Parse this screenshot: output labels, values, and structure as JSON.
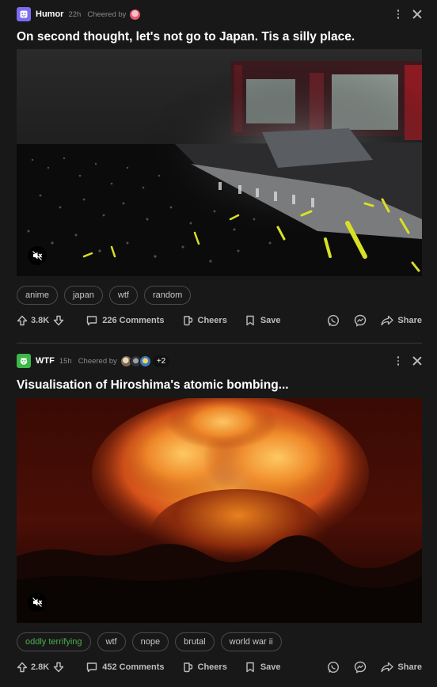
{
  "posts": [
    {
      "category": "Humor",
      "category_color": "#7c6cf0",
      "time": "22h",
      "cheered_by_label": "Cheered by",
      "extra_cheerers": "",
      "title": "On second thought, let's not go to Japan. Tis a silly place.",
      "tags": [
        "anime",
        "japan",
        "wtf",
        "random"
      ],
      "votes": "3.8K",
      "comments": "226 Comments",
      "cheers": "Cheers",
      "save": "Save",
      "share": "Share"
    },
    {
      "category": "WTF",
      "category_color": "#3cb84a",
      "time": "15h",
      "cheered_by_label": "Cheered by",
      "extra_cheerers": "+2",
      "title": "Visualisation of Hiroshima's atomic bombing...",
      "tags": [
        "oddly terrifying",
        "wtf",
        "nope",
        "brutal",
        "world war ii"
      ],
      "votes": "2.8K",
      "comments": "452 Comments",
      "cheers": "Cheers",
      "save": "Save",
      "share": "Share"
    }
  ]
}
